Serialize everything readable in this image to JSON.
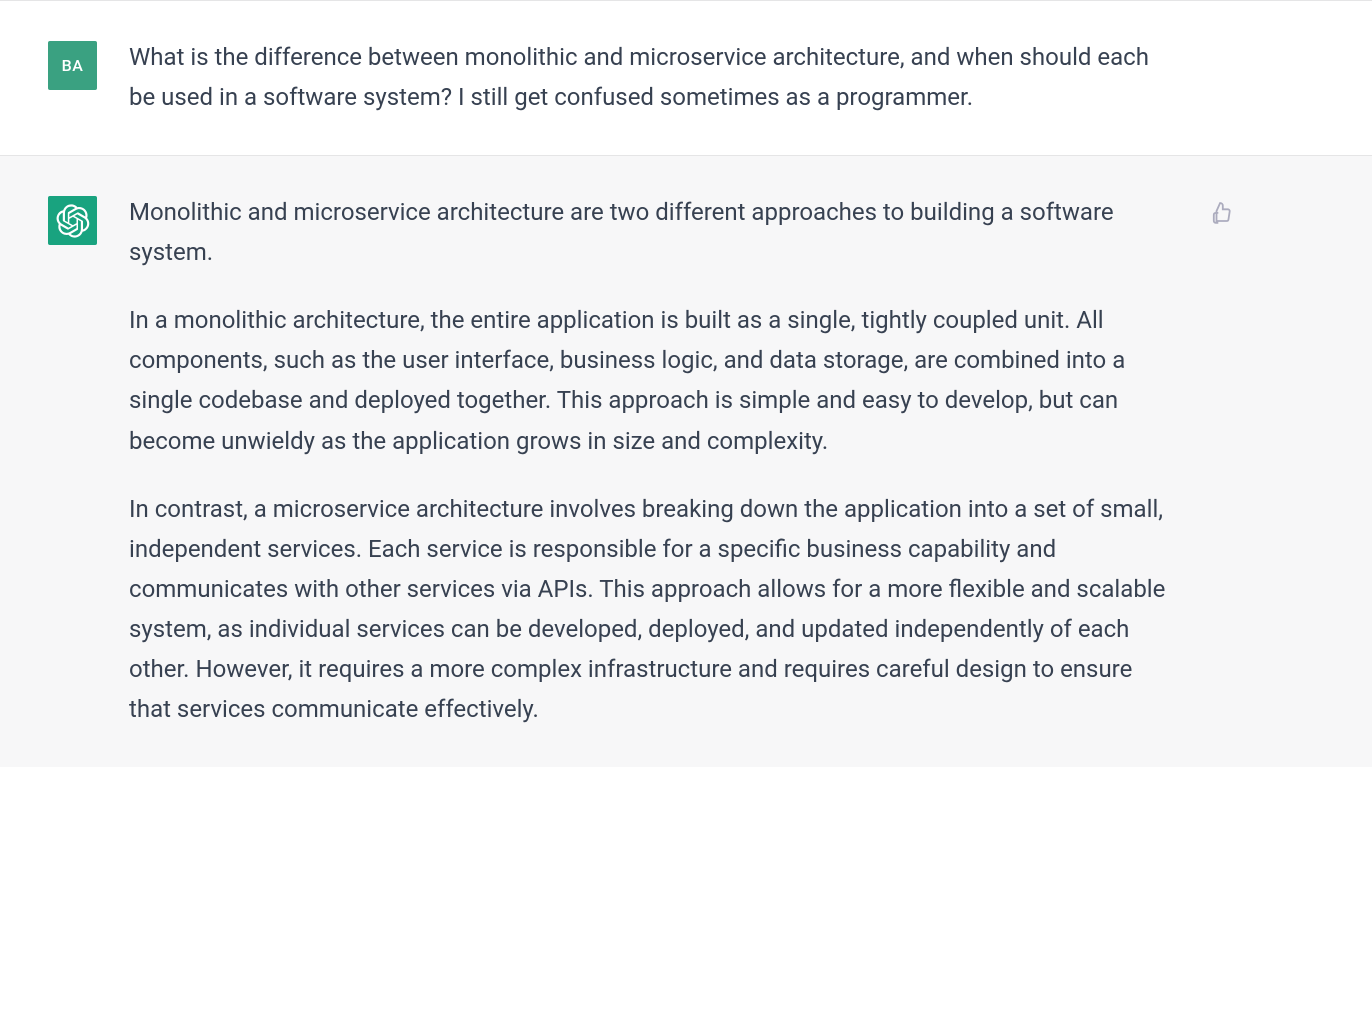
{
  "user_avatar_initials": "BA",
  "user_message": "What is the difference between monolithic and microservice architecture, and when should each be used in a software system? I still get confused sometimes as a programmer.",
  "assistant_message": {
    "p1": "Monolithic and microservice architecture are two different approaches to building a software system.",
    "p2": "In a monolithic architecture, the entire application is built as a single, tightly coupled unit. All components, such as the user interface, business logic, and data storage, are combined into a single codebase and deployed together. This approach is simple and easy to develop, but can become unwieldy as the application grows in size and complexity.",
    "p3": "In contrast, a microservice architecture involves breaking down the application into a set of small, independent services. Each service is responsible for a specific business capability and communicates with other services via APIs. This approach allows for a more flexible and scalable system, as individual services can be developed, deployed, and updated independently of each other. However, it requires a more complex infrastructure and requires careful design to ensure that services communicate effectively."
  }
}
